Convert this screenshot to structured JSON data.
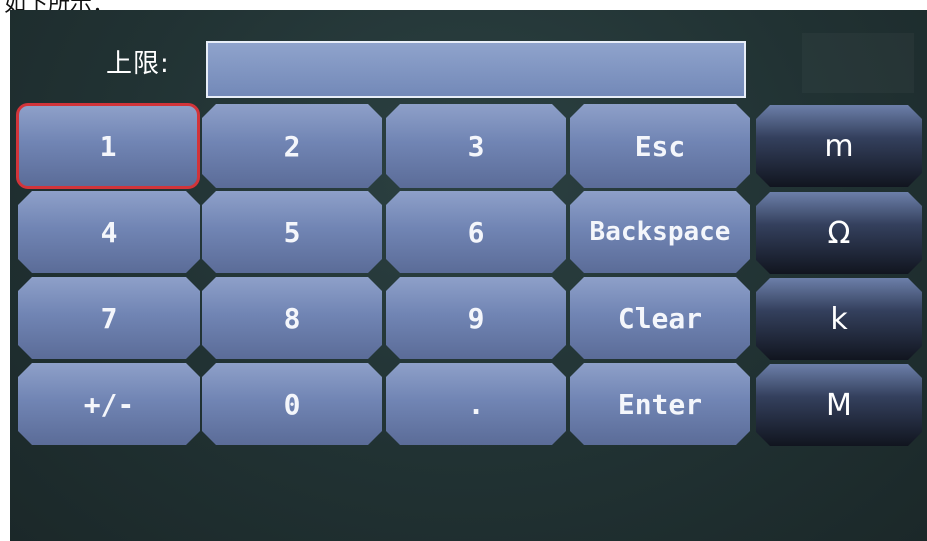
{
  "caption": "如下所示：",
  "input": {
    "label": "上限:",
    "value": ""
  },
  "keypad": {
    "rows": [
      [
        "1",
        "2",
        "3",
        "Esc"
      ],
      [
        "4",
        "5",
        "6",
        "Backspace"
      ],
      [
        "7",
        "8",
        "9",
        "Clear"
      ],
      [
        "+/-",
        "0",
        ".",
        "Enter"
      ]
    ],
    "selected_key": "1"
  },
  "units": [
    "m",
    "Ω",
    "k",
    "M"
  ],
  "colors": {
    "screen_background": "#213233",
    "key_fill": "#7f93c0",
    "unit_key_fill": "#1c2333",
    "selected_border": "#d2343a"
  }
}
